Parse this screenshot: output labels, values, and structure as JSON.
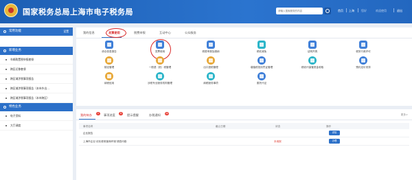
{
  "header": {
    "title": "国家税务总局上海市电子税务局",
    "search_placeholder": "请输入搜索服务的内容",
    "links": [
      "首页",
      "上海",
      "您好",
      "退出"
    ],
    "user_label": "欢迎使用"
  },
  "sidebar": {
    "sections": [
      {
        "title": "常用功能",
        "action": "设置",
        "items": []
      },
      {
        "title": "新增业务",
        "action": "",
        "items": [
          "车辆购置税申报套餐",
          "跨区迁移套餐",
          "跨区域涉税事项报告",
          "跨区域涉税事项报告（本市外出…",
          "跨区域涉税事项报告（本市跨区）"
        ]
      },
      {
        "title": "特色业务",
        "action": "",
        "items": [
          "电子资料",
          "大厅调度"
        ]
      }
    ]
  },
  "main_tabs": {
    "items": [
      "我的信息",
      "发票使用",
      "税费申报",
      "互动中心",
      "公众服务"
    ],
    "active_index": 1
  },
  "services": [
    {
      "label": "综合信息报告",
      "icon": "document-icon",
      "color": "#3f7fd8"
    },
    {
      "label": "发票使用",
      "icon": "invoice-icon",
      "color": "#3f7fd8"
    },
    {
      "label": "税费申报及缴纳",
      "icon": "tax-icon",
      "color": "#3f7fd8"
    },
    {
      "label": "税收减免",
      "icon": "reduction-icon",
      "color": "#2bb5c9"
    },
    {
      "label": "证明开具",
      "icon": "certificate-icon",
      "color": "#3f7fd8"
    },
    {
      "label": "税务行政许可",
      "icon": "license-icon",
      "color": "#3f7fd8"
    },
    {
      "label": "核定管理",
      "icon": "check-icon",
      "color": "#e8a93a"
    },
    {
      "label": "一般退（抵）税管理",
      "icon": "refund-icon",
      "color": "#e8a93a"
    },
    {
      "label": "出口退税管理",
      "icon": "export-icon",
      "color": "#e8a93a"
    },
    {
      "label": "增值税抵扣凭证管理",
      "icon": "voucher-icon",
      "color": "#3f7fd8"
    },
    {
      "label": "税收代保管资金收取",
      "icon": "fund-icon",
      "color": "#2bb5c9"
    },
    {
      "label": "预约定价安排",
      "icon": "pricing-icon",
      "color": "#3f7fd8"
    },
    {
      "label": "纳税信用",
      "icon": "credit-icon",
      "color": "#e8a93a"
    },
    {
      "label": "涉税专业服务机构管理",
      "icon": "agency-icon",
      "color": "#2bb5c9"
    },
    {
      "label": "纳税服务事项",
      "icon": "service-icon",
      "color": "#2bb5c9"
    },
    {
      "label": "委托代征",
      "icon": "entrust-icon",
      "color": "#3f7fd8"
    }
  ],
  "todo": {
    "tabs": [
      {
        "label": "我的待办",
        "badge": "2"
      },
      {
        "label": "事项进度",
        "badge": "8"
      },
      {
        "label": "提示提醒",
        "badge": ""
      },
      {
        "label": "办税通知",
        "badge": "10"
      }
    ],
    "more": "更多>",
    "columns": [
      "事项名称",
      "截止日期",
      "状态",
      "操作"
    ],
    "rows": [
      {
        "name": "企业报告",
        "deadline": "",
        "status": "",
        "action": "详情"
      },
      {
        "name": "上海市企业‘优化税收营商环境’调查问卷",
        "deadline": "",
        "status": "未填报",
        "action": "办理"
      }
    ]
  }
}
